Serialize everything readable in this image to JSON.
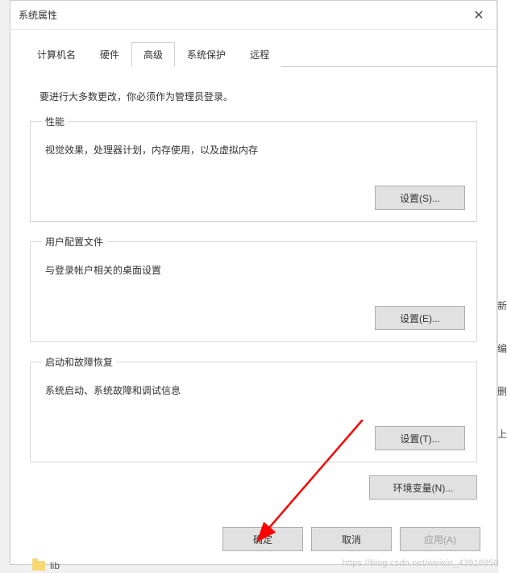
{
  "window": {
    "title": "系统属性",
    "close_glyph": "✕"
  },
  "tabs": {
    "t0": "计算机名",
    "t1": "硬件",
    "t2": "高级",
    "t3": "系统保护",
    "t4": "远程"
  },
  "intro": "要进行大多数更改，你必须作为管理员登录。",
  "sections": {
    "performance": {
      "legend": "性能",
      "desc": "视觉效果，处理器计划，内存使用，以及虚拟内存",
      "button": "设置(S)..."
    },
    "profiles": {
      "legend": "用户配置文件",
      "desc": "与登录帐户相关的桌面设置",
      "button": "设置(E)..."
    },
    "startup": {
      "legend": "启动和故障恢复",
      "desc": "系统启动、系统故障和调试信息",
      "button": "设置(T)..."
    }
  },
  "env_button": "环境变量(N)...",
  "buttons": {
    "ok": "确定",
    "cancel": "取消",
    "apply": "应用(A)"
  },
  "bg": {
    "folder_label": "lib"
  },
  "side": {
    "s1": "新",
    "s2": "编",
    "s3": "删",
    "s4": "上"
  },
  "watermark": "https://blog.csdn.net/weixin_43916850"
}
